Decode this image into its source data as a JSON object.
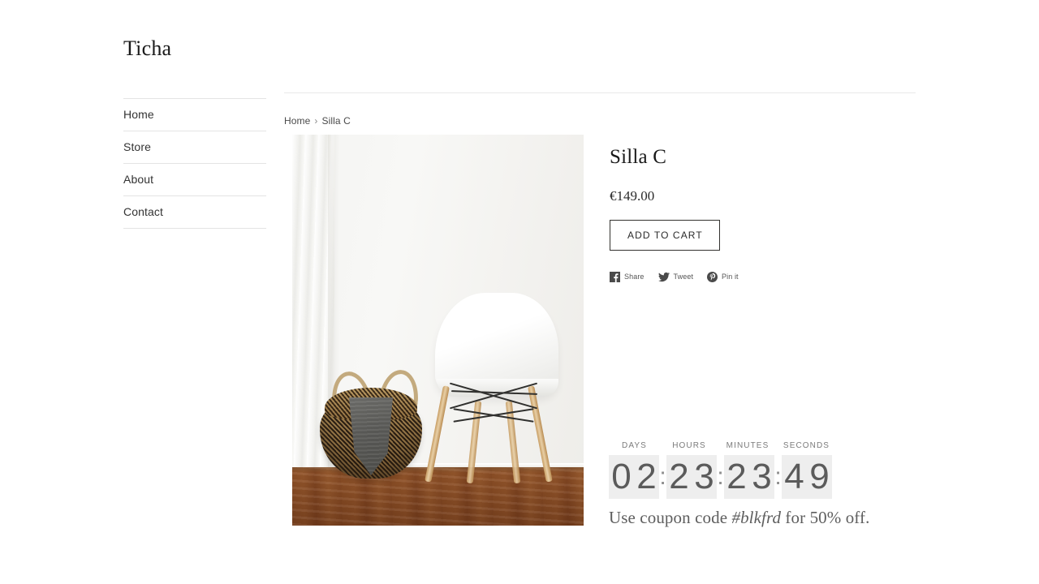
{
  "site": {
    "logo": "Ticha",
    "nav": [
      {
        "label": "Home"
      },
      {
        "label": "Store"
      },
      {
        "label": "About"
      },
      {
        "label": "Contact"
      }
    ]
  },
  "breadcrumb": {
    "home": "Home",
    "separator": "›",
    "current": "Silla C"
  },
  "product": {
    "title": "Silla C",
    "price": "€149.00",
    "add_to_cart_label": "ADD TO CART",
    "image_alt": "White molded chair with wooden dowel legs beside a woven seagrass basket holding a grey blanket, white curtain and wooden floor"
  },
  "share": [
    {
      "icon": "facebook-icon",
      "label": "Share"
    },
    {
      "icon": "twitter-icon",
      "label": "Tweet"
    },
    {
      "icon": "pinterest-icon",
      "label": "Pin it"
    }
  ],
  "countdown": {
    "labels": {
      "days": "DAYS",
      "hours": "HOURS",
      "minutes": "MINUTES",
      "seconds": "SECONDS"
    },
    "separator": ":",
    "days": {
      "d1": "0",
      "d2": "2"
    },
    "hours": {
      "d1": "2",
      "d2": "3"
    },
    "minutes": {
      "d1": "2",
      "d2": "3"
    },
    "seconds": {
      "d1": "4",
      "d2": "9"
    }
  },
  "promo": {
    "prefix": "Use coupon code ",
    "code": "#blkfrd",
    "suffix": " for 50% off."
  },
  "colors": {
    "text": "#333333",
    "heading": "#1a1a1a",
    "muted": "#7b7b7b",
    "rule": "#e4e4e4",
    "digit_bg": "#eeeeee",
    "digit_fg": "#5b5b5b",
    "button_border": "#33322f"
  }
}
